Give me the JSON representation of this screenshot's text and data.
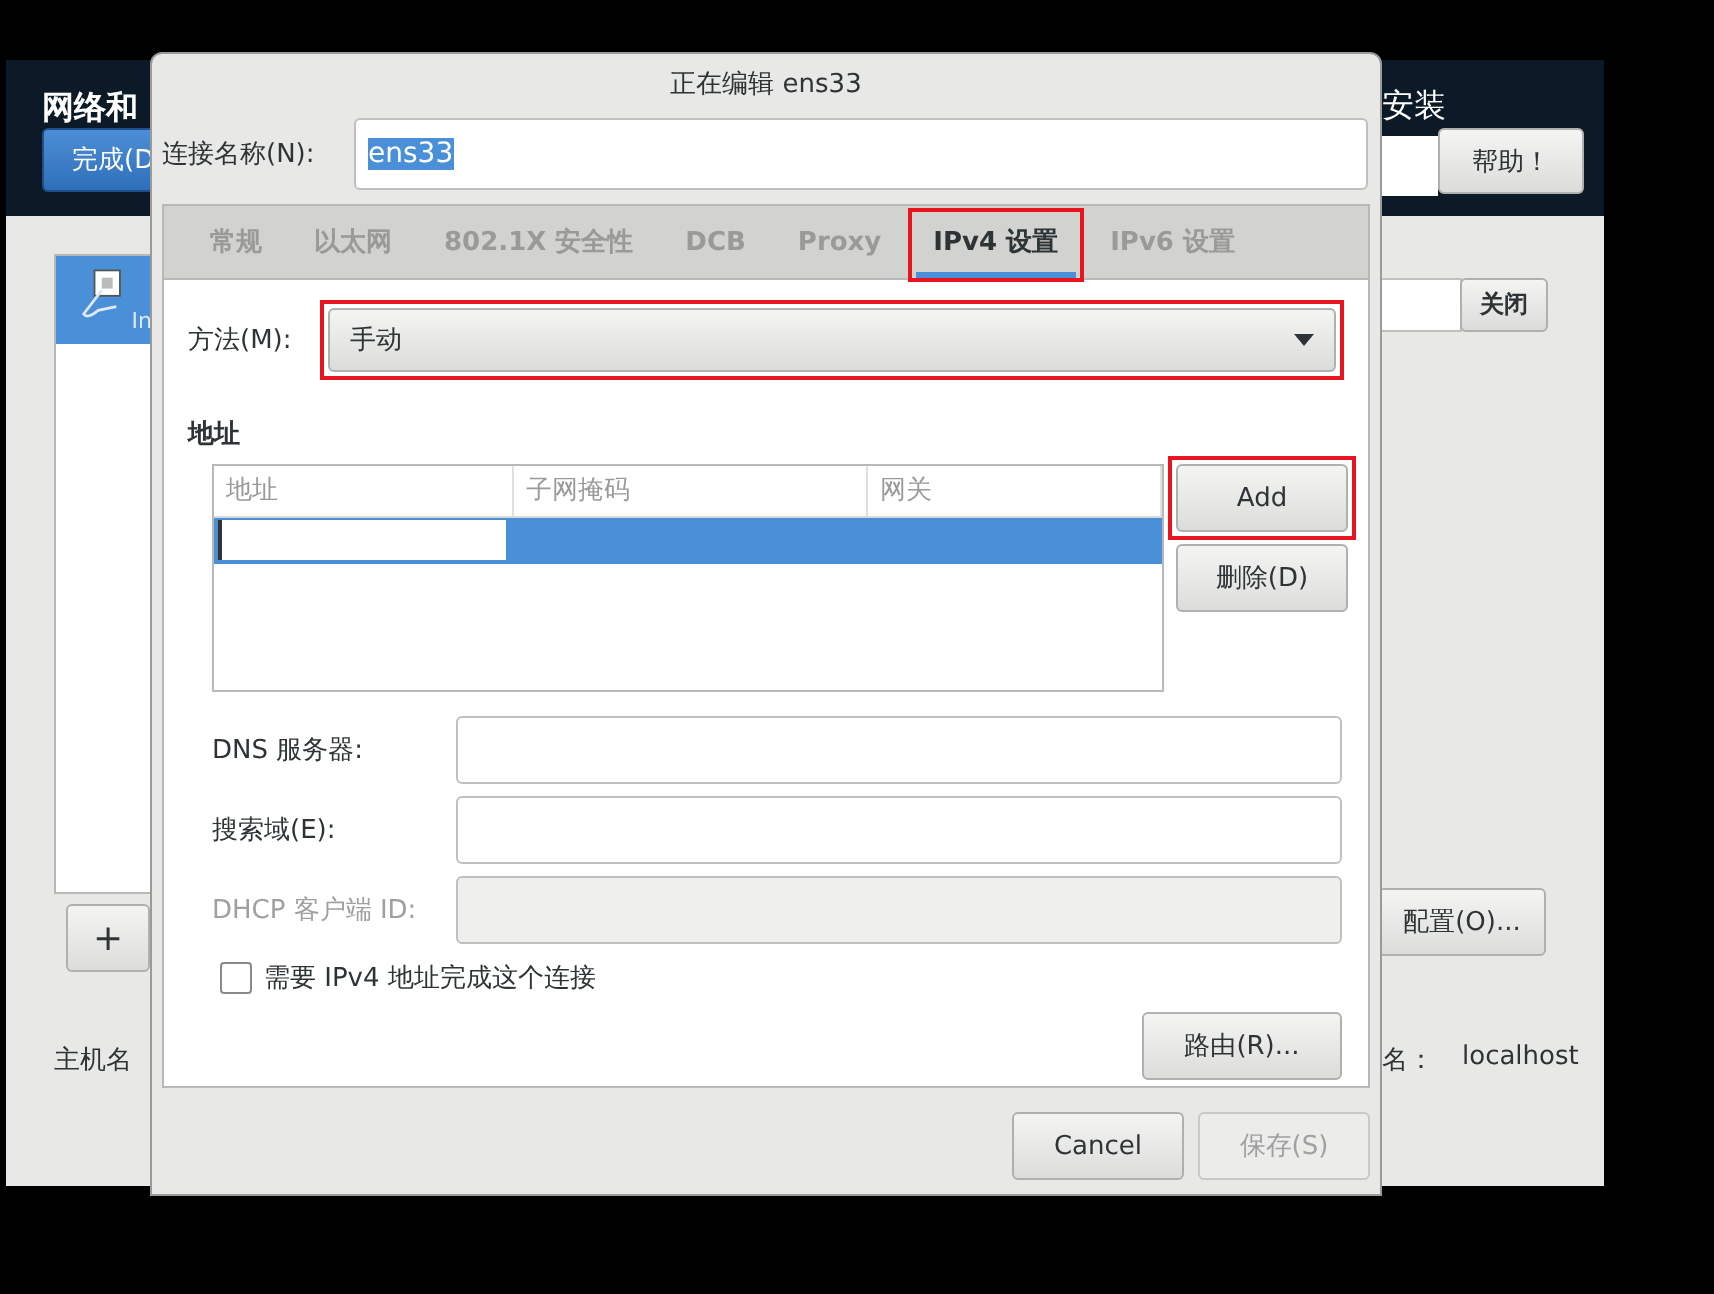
{
  "background_window": {
    "header_title": "网络和",
    "done_button": "完成(D",
    "header_right": "安装",
    "help_button": "帮助！",
    "connection_list": [
      {
        "sublabel": "In",
        "selected": true
      }
    ],
    "close_button": "关闭",
    "add_button": "+",
    "configure_button": "配置(O)...",
    "hostname_label": "主机名",
    "current_hostname_label": "名：",
    "current_hostname": "localhost"
  },
  "dialog": {
    "title": "正在编辑 ens33",
    "connection_name_label": "连接名称(N):",
    "connection_name": "ens33",
    "connection_name_selected": true,
    "tabs": [
      {
        "label": "常规",
        "selected": false,
        "highlighted": false
      },
      {
        "label": "以太网",
        "selected": false,
        "highlighted": false
      },
      {
        "label": "802.1X 安全性",
        "selected": false,
        "highlighted": false
      },
      {
        "label": "DCB",
        "selected": false,
        "highlighted": false
      },
      {
        "label": "Proxy",
        "selected": false,
        "highlighted": false
      },
      {
        "label": "IPv4 设置",
        "selected": true,
        "highlighted": true
      },
      {
        "label": "IPv6 设置",
        "selected": false,
        "highlighted": false
      }
    ],
    "method": {
      "label": "方法(M):",
      "value": "手动",
      "highlighted": true
    },
    "addresses": {
      "title": "地址",
      "columns": [
        "地址",
        "子网掩码",
        "网关"
      ],
      "rows": [
        {
          "selected": true,
          "editing": true
        }
      ]
    },
    "address_buttons": [
      {
        "label": "Add",
        "highlighted": true
      },
      {
        "label": "删除(D)",
        "highlighted": false
      }
    ],
    "fields": [
      {
        "label": "DNS 服务器:",
        "disabled": false
      },
      {
        "label": "搜索域(E):",
        "disabled": false
      },
      {
        "label": "DHCP 客户端 ID:",
        "disabled": true
      }
    ],
    "require_ipv4": {
      "label": "需要 IPv4 地址完成这个连接",
      "checked": false
    },
    "routes_button": "路由(R)...",
    "footer_buttons": [
      {
        "label": "Cancel",
        "disabled": false
      },
      {
        "label": "保存(S)",
        "disabled": true
      }
    ]
  }
}
